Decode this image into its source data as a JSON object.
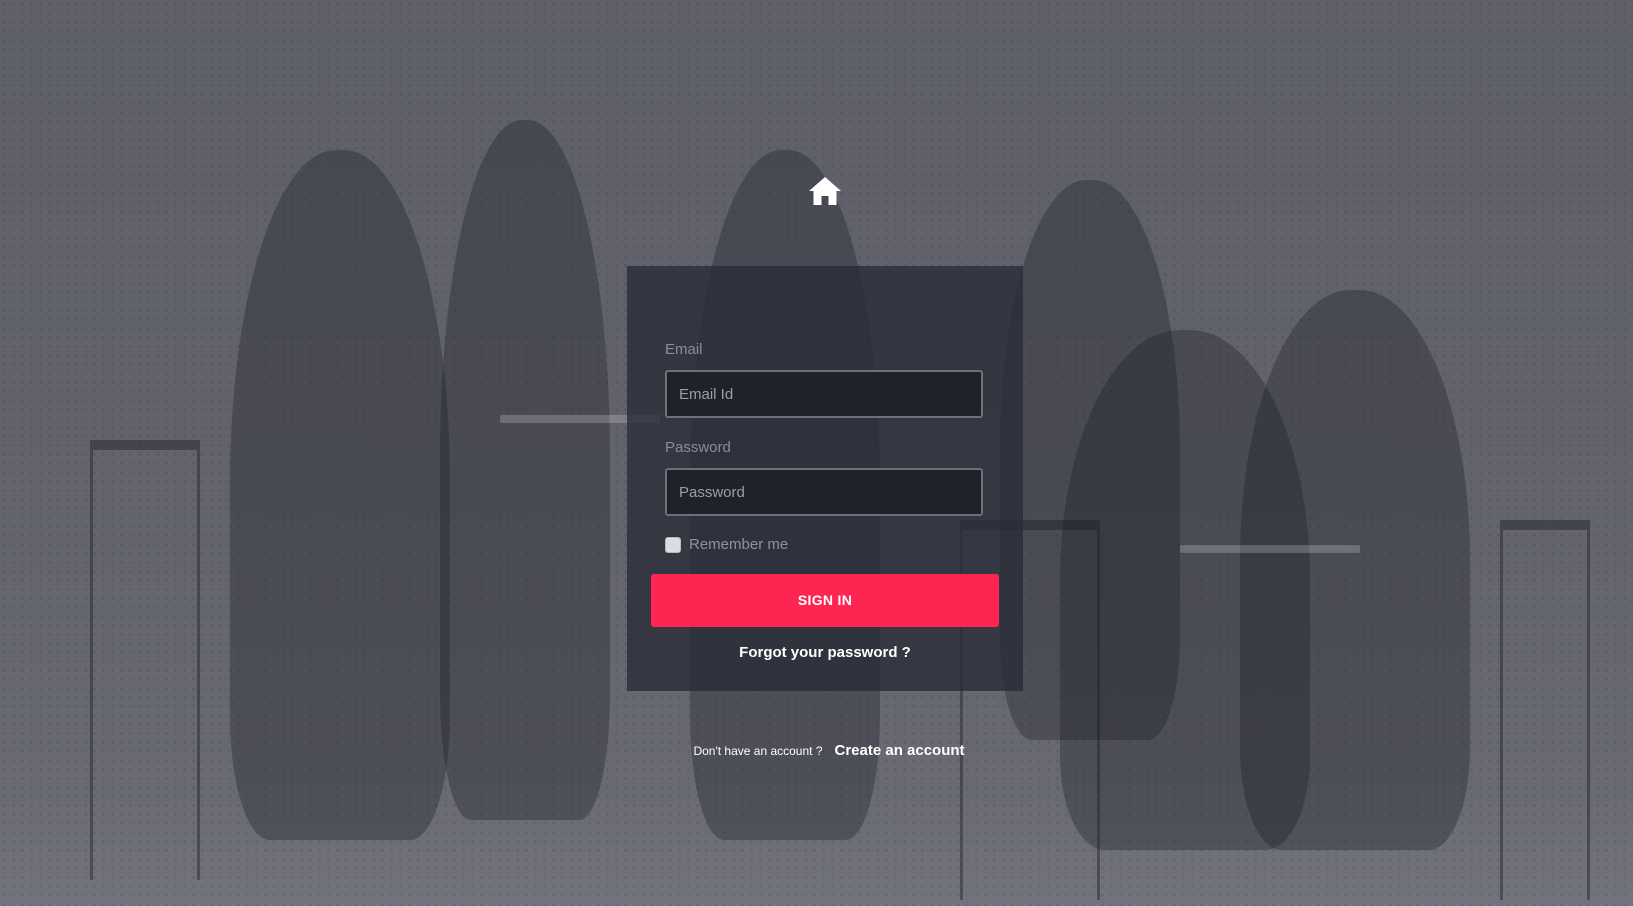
{
  "home": {
    "icon": "home-icon"
  },
  "form": {
    "email_label": "Email",
    "email_placeholder": "Email Id",
    "email_value": "",
    "password_label": "Password",
    "password_placeholder": "Password",
    "password_value": "",
    "remember_label": "Remember me",
    "remember_checked": false,
    "signin_label": "SIGN IN",
    "forgot_label": "Forgot your password ?"
  },
  "signup": {
    "prompt": "Don't have an account ?",
    "link_label": "Create an account"
  },
  "colors": {
    "accent": "#ff2553",
    "panel": "#282c36",
    "input_bg": "#1f2329"
  }
}
